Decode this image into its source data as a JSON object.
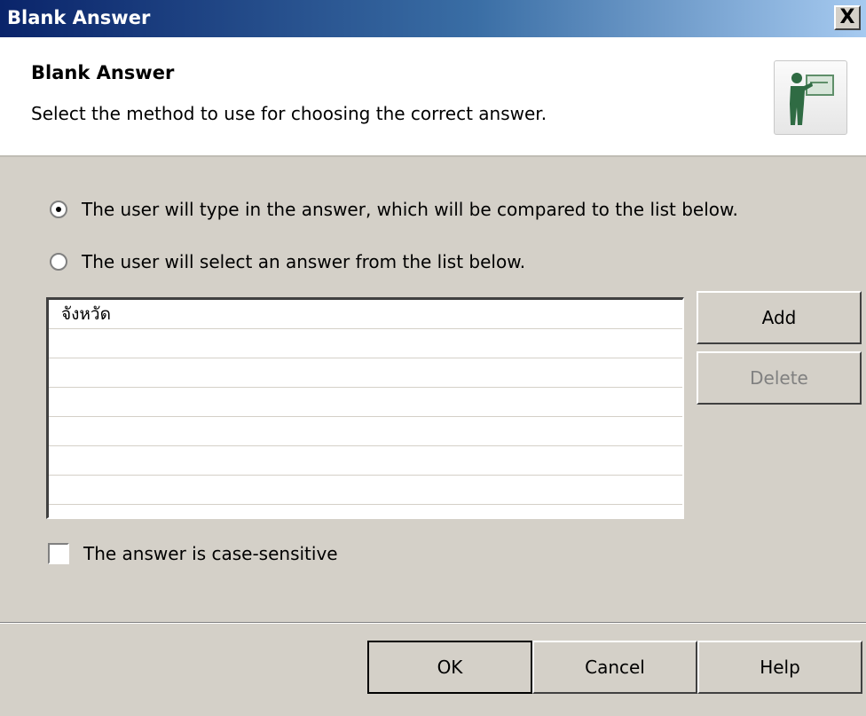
{
  "window": {
    "title": "Blank Answer",
    "close_label": "X"
  },
  "header": {
    "title": "Blank Answer",
    "description": "Select the method to use for choosing the correct answer.",
    "icon": "presenter-icon"
  },
  "options": {
    "type_answer": {
      "label": "The user will type in the answer, which will be compared to the list below.",
      "selected": true
    },
    "select_answer": {
      "label": "The user will select an answer from the list below.",
      "selected": false
    }
  },
  "answers": {
    "items": [
      "จังหวัด",
      "",
      "",
      "",
      "",
      "",
      ""
    ]
  },
  "buttons": {
    "add": "Add",
    "delete": "Delete",
    "ok": "OK",
    "cancel": "Cancel",
    "help": "Help"
  },
  "case_sensitive": {
    "label": "The answer is case-sensitive",
    "checked": false
  }
}
